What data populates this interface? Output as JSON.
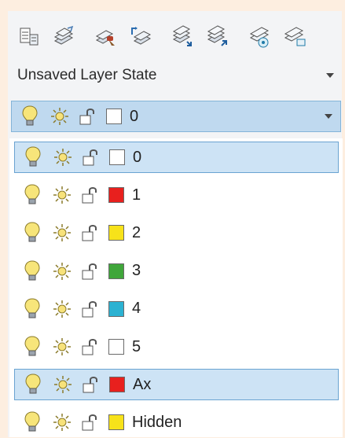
{
  "toolbar": {
    "icons": [
      "layer-properties-icon",
      "layer-states-icon",
      "make-current-icon",
      "match-layer-icon",
      "previous-layer-icon",
      "layer-walk-icon",
      "isolate-layer-icon",
      "unisolate-layer-icon"
    ]
  },
  "layer_state": {
    "label": "Unsaved Layer State"
  },
  "current_layer": {
    "name": "0",
    "color": "#ffffff"
  },
  "layers": [
    {
      "name": "0",
      "color": "#ffffff",
      "selected": true
    },
    {
      "name": "1",
      "color": "#e8201e",
      "selected": false
    },
    {
      "name": "2",
      "color": "#f7e21a",
      "selected": false
    },
    {
      "name": "3",
      "color": "#3fa63a",
      "selected": false
    },
    {
      "name": "4",
      "color": "#2cb2d2",
      "selected": false
    },
    {
      "name": "5",
      "color": "#ffffff",
      "selected": false
    },
    {
      "name": "Ax",
      "color": "#e8201e",
      "selected": true
    },
    {
      "name": "Hidden",
      "color": "#f7e21a",
      "selected": false
    }
  ]
}
